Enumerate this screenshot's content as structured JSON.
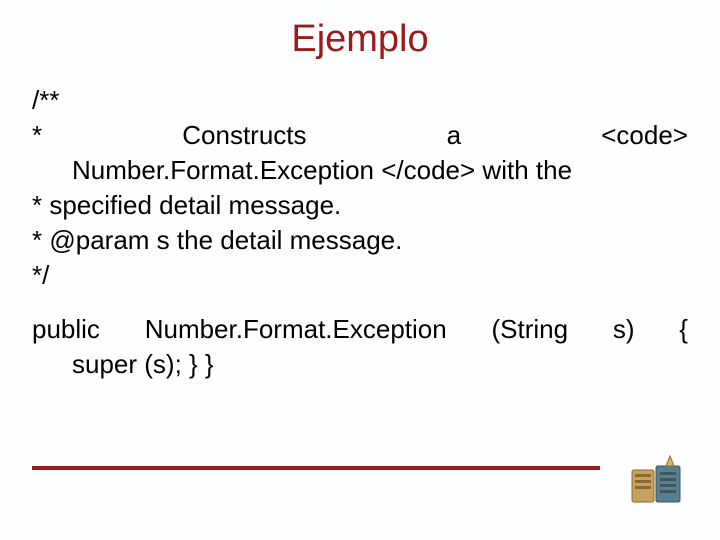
{
  "title": "Ejemplo",
  "doc": {
    "l1": "/**",
    "l2a": "*",
    "l2b": "Constructs",
    "l2c": "a",
    "l2d": "<code>",
    "l3": "Number.Format.Exception </code> with the",
    "l4": "* specified detail message.",
    "l5": "* @param s the detail message.",
    "l6": "*/"
  },
  "code": {
    "l1a": "public",
    "l1b": "Number.Format.Exception",
    "l1c": "(String",
    "l1d": "s)",
    "l1e": "{",
    "l2": "super (s); } }"
  }
}
